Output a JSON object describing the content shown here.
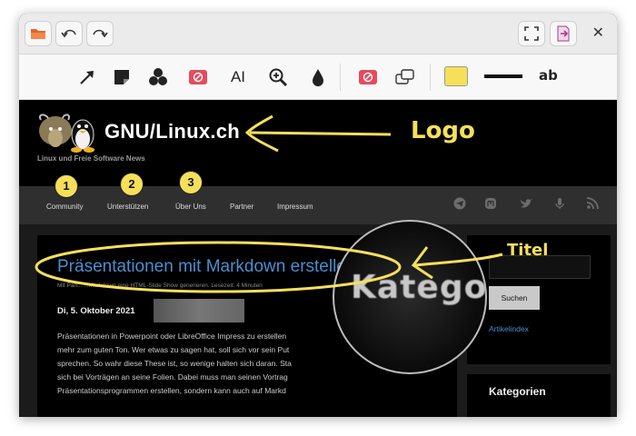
{
  "toolbar": {
    "font_tool_label": "ab",
    "text_tool_label": "AI",
    "fill_color": "#f6e05a"
  },
  "site": {
    "logo_text": "GNU/Linux.ch",
    "tagline": "Linux und Freie Software News",
    "nav": [
      "Community",
      "Unterstützen",
      "Über Uns",
      "Partner",
      "Impressum"
    ],
    "social_icons": [
      "telegram-icon",
      "mastodon-icon",
      "twitter-icon",
      "podcast-icon",
      "rss-icon"
    ]
  },
  "post": {
    "title": "Präsentationen mit Markdown erstellen",
    "subtitle": "Mit Pan... ...Markdown eine HTML-Slide Show generieren. Lesezeit: 4 Minuten",
    "date": "Di, 5. Oktober 2021",
    "lines": [
      "Präsentationen in Powerpoint oder LibreOffice Impress zu erstellen",
      "mehr zum guten Ton. Wer etwas zu sagen hat, soll sich vor sein Put",
      "sprechen. So wahr diese These ist, so wenige halten sich daran. Sta",
      "sich bei Vorträgen an seine Folien. Dabei muss man seinen Vortrag",
      "Präsentationsprogrammen erstellen, sondern kann auch auf Markd"
    ]
  },
  "sidebar": {
    "search_button": "Suchen",
    "link": "Artikelindex",
    "heading": "Kategorien"
  },
  "magnifier": {
    "text": "Katego"
  },
  "annotations": {
    "logo_label": "Logo",
    "title_label": "Titel",
    "badges": [
      "1",
      "2",
      "3"
    ],
    "accent_color": "#f6e05a"
  }
}
